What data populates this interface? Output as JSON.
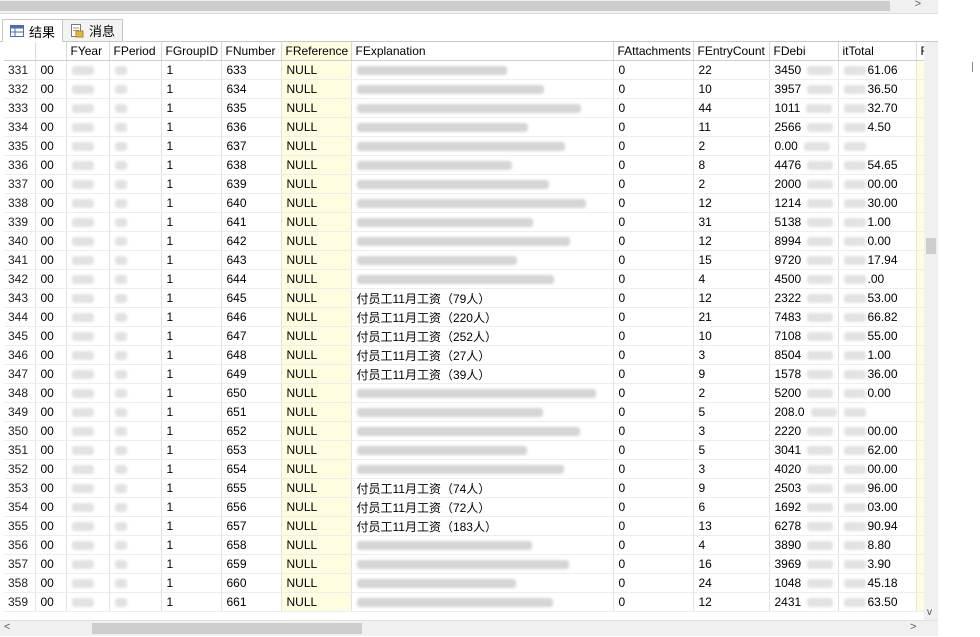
{
  "tabs": {
    "results": "结果",
    "messages": "消息"
  },
  "scroll": {
    "left_arrow": "<",
    "right_arrow": ">",
    "down_arrow": "v"
  },
  "columns": [
    "",
    "",
    "FYear",
    "FPeriod",
    "FGroupID",
    "FNumber",
    "FReference",
    "FExplanation",
    "FAttachments",
    "FEntryCount",
    "FDebi",
    "itTotal",
    "F"
  ],
  "rows": [
    {
      "rn": "331",
      "id": "00",
      "group": "1",
      "num": "633",
      "ref": "NULL",
      "expl": "",
      "att": "0",
      "cnt": "22",
      "debit": "3450",
      "credit": "61.06"
    },
    {
      "rn": "332",
      "id": "00",
      "group": "1",
      "num": "634",
      "ref": "NULL",
      "expl": "",
      "att": "0",
      "cnt": "10",
      "debit": "3957",
      "credit": "36.50"
    },
    {
      "rn": "333",
      "id": "00",
      "group": "1",
      "num": "635",
      "ref": "NULL",
      "expl": "",
      "att": "0",
      "cnt": "44",
      "debit": "1011",
      "credit": "32.70"
    },
    {
      "rn": "334",
      "id": "00",
      "group": "1",
      "num": "636",
      "ref": "NULL",
      "expl": "",
      "att": "0",
      "cnt": "11",
      "debit": "2566",
      "credit": "4.50"
    },
    {
      "rn": "335",
      "id": "00",
      "group": "1",
      "num": "637",
      "ref": "NULL",
      "expl": "",
      "att": "0",
      "cnt": "2",
      "debit": "0.00",
      "credit": ""
    },
    {
      "rn": "336",
      "id": "00",
      "group": "1",
      "num": "638",
      "ref": "NULL",
      "expl": "",
      "att": "0",
      "cnt": "8",
      "debit": "4476",
      "credit": "54.65"
    },
    {
      "rn": "337",
      "id": "00",
      "group": "1",
      "num": "639",
      "ref": "NULL",
      "expl": "",
      "att": "0",
      "cnt": "2",
      "debit": "2000",
      "credit": "00.00"
    },
    {
      "rn": "338",
      "id": "00",
      "group": "1",
      "num": "640",
      "ref": "NULL",
      "expl": "",
      "att": "0",
      "cnt": "12",
      "debit": "1214",
      "credit": "30.00"
    },
    {
      "rn": "339",
      "id": "00",
      "group": "1",
      "num": "641",
      "ref": "NULL",
      "expl": "",
      "att": "0",
      "cnt": "31",
      "debit": "5138",
      "credit": "1.00"
    },
    {
      "rn": "340",
      "id": "00",
      "group": "1",
      "num": "642",
      "ref": "NULL",
      "expl": "",
      "att": "0",
      "cnt": "12",
      "debit": "8994",
      "credit": "0.00"
    },
    {
      "rn": "341",
      "id": "00",
      "group": "1",
      "num": "643",
      "ref": "NULL",
      "expl": "",
      "att": "0",
      "cnt": "15",
      "debit": "9720",
      "credit": "17.94"
    },
    {
      "rn": "342",
      "id": "00",
      "group": "1",
      "num": "644",
      "ref": "NULL",
      "expl": "",
      "att": "0",
      "cnt": "4",
      "debit": "4500",
      "credit": ".00"
    },
    {
      "rn": "343",
      "id": "00",
      "group": "1",
      "num": "645",
      "ref": "NULL",
      "expl": "付员工11月工资（79人）",
      "att": "0",
      "cnt": "12",
      "debit": "2322",
      "credit": "53.00"
    },
    {
      "rn": "344",
      "id": "00",
      "group": "1",
      "num": "646",
      "ref": "NULL",
      "expl": "付员工11月工资（220人）",
      "att": "0",
      "cnt": "21",
      "debit": "7483",
      "credit": "66.82"
    },
    {
      "rn": "345",
      "id": "00",
      "group": "1",
      "num": "647",
      "ref": "NULL",
      "expl": "付员工11月工资（252人）",
      "att": "0",
      "cnt": "10",
      "debit": "7108",
      "credit": "55.00"
    },
    {
      "rn": "346",
      "id": "00",
      "group": "1",
      "num": "648",
      "ref": "NULL",
      "expl": "付员工11月工资（27人）",
      "att": "0",
      "cnt": "3",
      "debit": "8504",
      "credit": "1.00"
    },
    {
      "rn": "347",
      "id": "00",
      "group": "1",
      "num": "649",
      "ref": "NULL",
      "expl": "付员工11月工资（39人）",
      "att": "0",
      "cnt": "9",
      "debit": "1578",
      "credit": "36.00"
    },
    {
      "rn": "348",
      "id": "00",
      "group": "1",
      "num": "650",
      "ref": "NULL",
      "expl": "",
      "att": "0",
      "cnt": "2",
      "debit": "5200",
      "credit": "0.00"
    },
    {
      "rn": "349",
      "id": "00",
      "group": "1",
      "num": "651",
      "ref": "NULL",
      "expl": "",
      "att": "0",
      "cnt": "5",
      "debit": "208.0",
      "credit": ""
    },
    {
      "rn": "350",
      "id": "00",
      "group": "1",
      "num": "652",
      "ref": "NULL",
      "expl": "",
      "att": "0",
      "cnt": "3",
      "debit": "2220",
      "credit": "00.00"
    },
    {
      "rn": "351",
      "id": "00",
      "group": "1",
      "num": "653",
      "ref": "NULL",
      "expl": "",
      "att": "0",
      "cnt": "5",
      "debit": "3041",
      "credit": "62.00"
    },
    {
      "rn": "352",
      "id": "00",
      "group": "1",
      "num": "654",
      "ref": "NULL",
      "expl": "",
      "att": "0",
      "cnt": "3",
      "debit": "4020",
      "credit": "00.00"
    },
    {
      "rn": "353",
      "id": "00",
      "group": "1",
      "num": "655",
      "ref": "NULL",
      "expl": "付员工11月工资（74人）",
      "att": "0",
      "cnt": "9",
      "debit": "2503",
      "credit": "96.00"
    },
    {
      "rn": "354",
      "id": "00",
      "group": "1",
      "num": "656",
      "ref": "NULL",
      "expl": "付员工11月工资（72人）",
      "att": "0",
      "cnt": "6",
      "debit": "1692",
      "credit": "03.00"
    },
    {
      "rn": "355",
      "id": "00",
      "group": "1",
      "num": "657",
      "ref": "NULL",
      "expl": "付员工11月工资（183人）",
      "att": "0",
      "cnt": "13",
      "debit": "6278",
      "credit": "90.94"
    },
    {
      "rn": "356",
      "id": "00",
      "group": "1",
      "num": "658",
      "ref": "NULL",
      "expl": "",
      "att": "0",
      "cnt": "4",
      "debit": "3890",
      "credit": "8.80"
    },
    {
      "rn": "357",
      "id": "00",
      "group": "1",
      "num": "659",
      "ref": "NULL",
      "expl": "",
      "att": "0",
      "cnt": "16",
      "debit": "3969",
      "credit": "3.90"
    },
    {
      "rn": "358",
      "id": "00",
      "group": "1",
      "num": "660",
      "ref": "NULL",
      "expl": "",
      "att": "0",
      "cnt": "24",
      "debit": "1048",
      "credit": "45.18"
    },
    {
      "rn": "359",
      "id": "00",
      "group": "1",
      "num": "661",
      "ref": "NULL",
      "expl": "",
      "att": "0",
      "cnt": "12",
      "debit": "2431",
      "credit": "63.50"
    }
  ]
}
